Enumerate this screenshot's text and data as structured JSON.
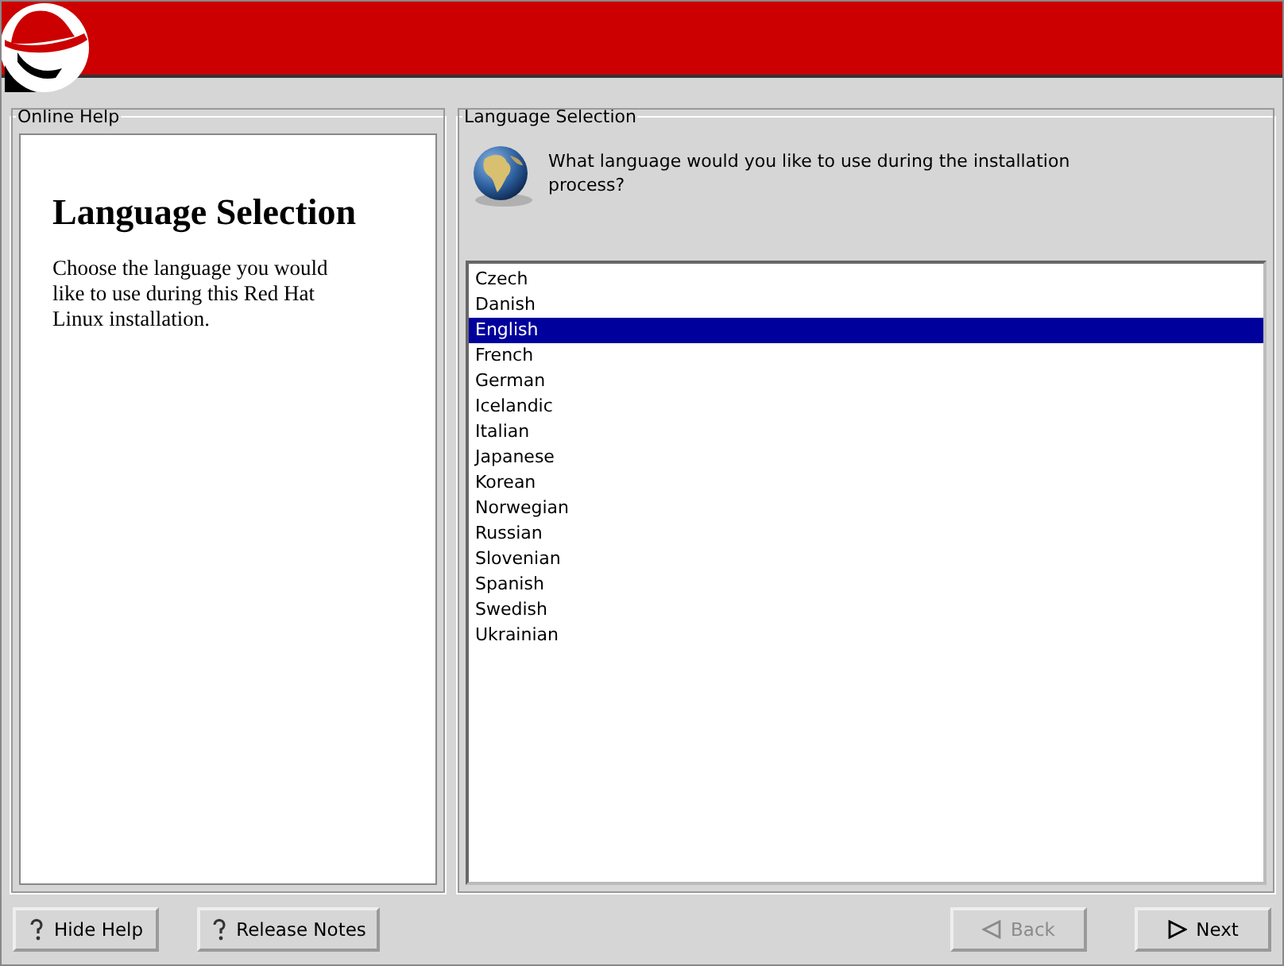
{
  "help": {
    "legend": "Online Help",
    "title": "Language Selection",
    "body": "Choose the language you would like to use during this Red Hat Linux installation."
  },
  "language": {
    "legend": "Language Selection",
    "question": "What language would you like to use during the installation process?",
    "items": [
      {
        "label": "Czech",
        "selected": false
      },
      {
        "label": "Danish",
        "selected": false
      },
      {
        "label": "English",
        "selected": true
      },
      {
        "label": "French",
        "selected": false
      },
      {
        "label": "German",
        "selected": false
      },
      {
        "label": "Icelandic",
        "selected": false
      },
      {
        "label": "Italian",
        "selected": false
      },
      {
        "label": "Japanese",
        "selected": false
      },
      {
        "label": "Korean",
        "selected": false
      },
      {
        "label": "Norwegian",
        "selected": false
      },
      {
        "label": "Russian",
        "selected": false
      },
      {
        "label": "Slovenian",
        "selected": false
      },
      {
        "label": "Spanish",
        "selected": false
      },
      {
        "label": "Swedish",
        "selected": false
      },
      {
        "label": "Ukrainian",
        "selected": false
      }
    ]
  },
  "buttons_left": [
    {
      "label": "Hide Help",
      "kind": "help",
      "disabled": false
    },
    {
      "label": "Release Notes",
      "kind": "help",
      "disabled": false
    }
  ],
  "buttons_right": [
    {
      "label": "Back",
      "kind": "back",
      "disabled": true
    },
    {
      "label": "Next",
      "kind": "next",
      "disabled": false
    }
  ]
}
